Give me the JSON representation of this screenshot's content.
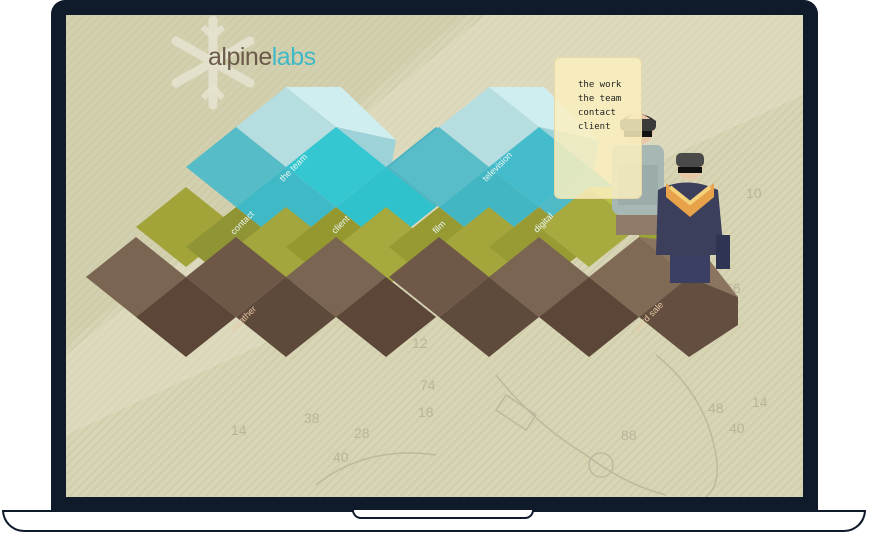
{
  "logo": {
    "part1": "alpine",
    "part2": "labs"
  },
  "menu": [
    "the work",
    "the team",
    "contact",
    "client"
  ],
  "cube_labels": {
    "the_team": "the team",
    "contact": "contact",
    "client": "client",
    "television": "television",
    "film": "film",
    "digital": "digital",
    "weather": "weather",
    "yard_sale": "yard sale"
  },
  "colors": {
    "background": "#d7d4b4",
    "brand_brown": "#6b5a4a",
    "brand_teal": "#3fb8c8"
  },
  "icons": [
    "snowflake-icon"
  ]
}
